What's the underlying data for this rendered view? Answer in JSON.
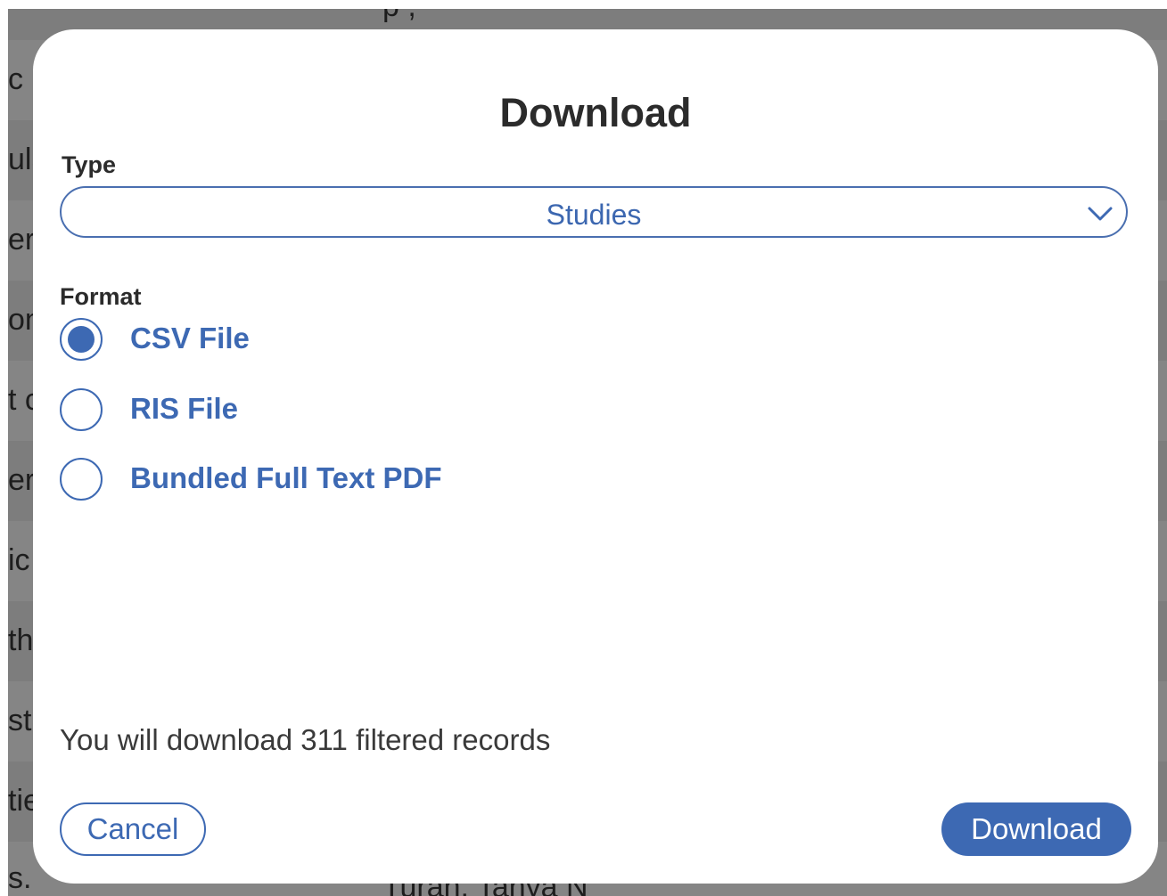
{
  "background": {
    "row_fragments": [
      "c",
      "ula",
      "er",
      "ons",
      "t c",
      "er",
      "ic",
      "th",
      "st",
      "tie",
      "s."
    ],
    "top_fragment": "p ,",
    "bottom_fragment": "Turan, Tanya N"
  },
  "modal": {
    "title": "Download",
    "type_label": "Type",
    "type_value": "Studies",
    "format_label": "Format",
    "format_options": [
      {
        "label": "CSV File",
        "selected": true
      },
      {
        "label": "RIS File",
        "selected": false
      },
      {
        "label": "Bundled Full Text PDF",
        "selected": false
      }
    ],
    "info_text": "You will download 311 filtered records",
    "cancel_label": "Cancel",
    "download_label": "Download"
  },
  "colors": {
    "accent": "#3d69b3",
    "backdrop": "#7d7d7d",
    "title_text": "#2b2b2b"
  },
  "icons": {
    "select_chevron": "chevron-down-icon"
  }
}
